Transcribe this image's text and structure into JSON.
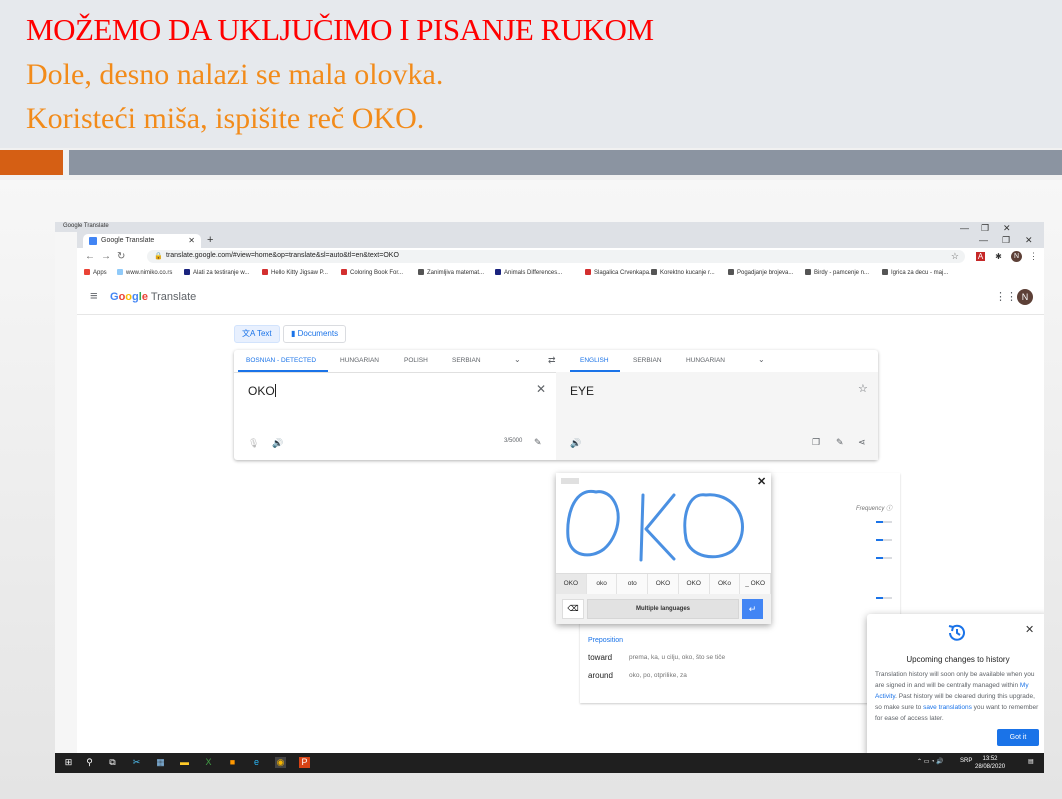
{
  "slide": {
    "title": "MOŽEMO DA UKLJUČIMO I PISANJE RUKOM",
    "line1": "Dole, desno nalazi se mala olovka.",
    "line2": "Koristeći miša, ispišite  reč OKO."
  },
  "browser": {
    "bg_tab_title": "Google Translate",
    "tab_title": "Google Translate",
    "url": "translate.google.com/#view=home&op=translate&sl=auto&tl=en&text=OKO",
    "avatar_initial": "N",
    "bookmarks": [
      {
        "label": "Apps",
        "icon": "apps-icon",
        "color": "#ea4335"
      },
      {
        "label": "www.nimiko.co.rs",
        "icon": "globe-icon",
        "color": "#90caf9"
      },
      {
        "label": "Alati za testiranje w...",
        "icon": "s-icon",
        "color": "#1a237e"
      },
      {
        "label": "Hello Kitty Jigsaw P...",
        "icon": "pin-icon",
        "color": "#d32f2f"
      },
      {
        "label": "Coloring Book For...",
        "icon": "pin-icon",
        "color": "#d32f2f"
      },
      {
        "label": "Zanimljiva matemat...",
        "icon": "globe-icon",
        "color": "#555555"
      },
      {
        "label": "Animals Differences...",
        "icon": "grid-icon",
        "color": "#1a237e"
      },
      {
        "label": "Slagalica Crvenkapa...",
        "icon": "pin-icon",
        "color": "#d32f2f"
      },
      {
        "label": "Korektno kucanje r...",
        "icon": "globe-icon",
        "color": "#555555"
      },
      {
        "label": "Pogadjanje brojeva...",
        "icon": "globe-icon",
        "color": "#555555"
      },
      {
        "label": "Birdy - pamcenje n...",
        "icon": "globe-icon",
        "color": "#555555"
      },
      {
        "label": "Igrica za decu - maj...",
        "icon": "globe-icon",
        "color": "#555555"
      }
    ]
  },
  "translate": {
    "logo_google": "Google",
    "logo_translate": "Translate",
    "avatar_initial": "N",
    "mode_text": "Text",
    "mode_documents": "Documents",
    "source_langs": [
      "BOSNIAN - DETECTED",
      "HUNGARIAN",
      "POLISH",
      "SERBIAN"
    ],
    "target_langs": [
      "ENGLISH",
      "SERBIAN",
      "HUNGARIAN"
    ],
    "source_text": "OKO",
    "target_text": "EYE",
    "char_count": "3/5000",
    "accent": "#1a73e8"
  },
  "handwriting": {
    "suggestions": [
      "OKO",
      "oko",
      "oto",
      "OKO",
      "OKO",
      "OKo",
      "_ OKO"
    ],
    "multi_languages": "Multiple languages",
    "stroke_color": "#4a90e2"
  },
  "dictionary": {
    "frequency_label": "Frequency",
    "pos": "Preposition",
    "entries": [
      {
        "word": "toward",
        "translations": "prema, ka, u cilju, oko, što se tiče"
      },
      {
        "word": "around",
        "translations": "oko, po, otprilike, za"
      }
    ]
  },
  "popup": {
    "title": "Upcoming changes to history",
    "body_1": "Translation history will soon only be available when you are signed in and will be centrally managed within",
    "link_1": "My Activity",
    "body_2": ". Past history will be cleared during this upgrade, so make sure to",
    "link_2": "save translations",
    "body_3": "you want to remember for ease of access later.",
    "button": "Got it"
  },
  "taskbar": {
    "language": "SRP",
    "time": "13:52",
    "date": "28/08/2020"
  }
}
